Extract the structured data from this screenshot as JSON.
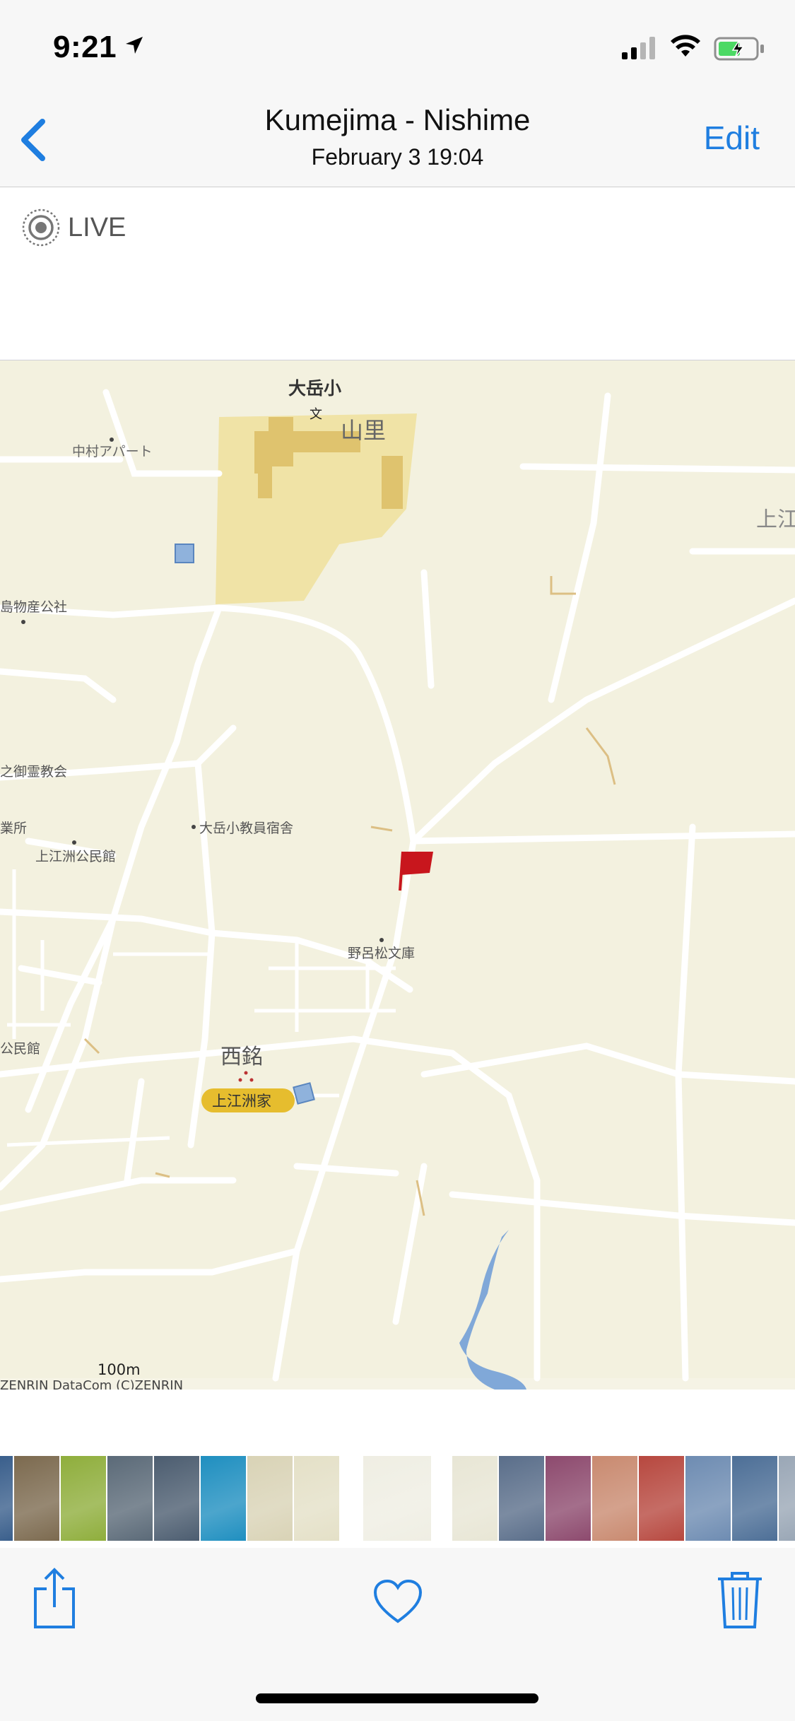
{
  "status_bar": {
    "time": "9:21"
  },
  "nav": {
    "back_label": "Back",
    "title": "Kumejima - Nishime",
    "subtitle": "February 3  19:04",
    "edit_label": "Edit"
  },
  "live_badge": {
    "label": "LIVE"
  },
  "map_photo": {
    "labels": {
      "school": "大岳小",
      "yamazato": "山里",
      "nakamura_apart": "中村アパート",
      "kami_partial": "上江",
      "bussan_kosha": "島物産公社",
      "church": "之御霊教会",
      "teacher_dorm": "大岳小教員宿舎",
      "office_partial": "業所",
      "community_hall": "上江洲公民館",
      "library": "野呂松文庫",
      "hall_partial": "公民館",
      "nishime": "西銘",
      "uezu_house": "上江洲家",
      "scale": "100m",
      "copyright": "ZENRIN DataCom (C)ZENRIN"
    }
  },
  "film_strip": {
    "thumb_colors": [
      "#3a5f8c",
      "#7c6a4f",
      "#8fae3c",
      "#5b6a78",
      "#4c5d70",
      "#1f8fc0",
      "#d9d3b6",
      "#e4e0c7",
      "#efeee3",
      "#e8e6d5",
      "#5a6e8a",
      "#8d4a6e",
      "#c98a70",
      "#b7483f",
      "#6e8cb2",
      "#4d6f97",
      "#9aa7b6"
    ]
  },
  "toolbar": {
    "share_icon": "share-icon",
    "favorite_icon": "heart-icon",
    "delete_icon": "trash-icon"
  },
  "colors": {
    "accent": "#1f7ee0",
    "flag": "#c8161d"
  }
}
